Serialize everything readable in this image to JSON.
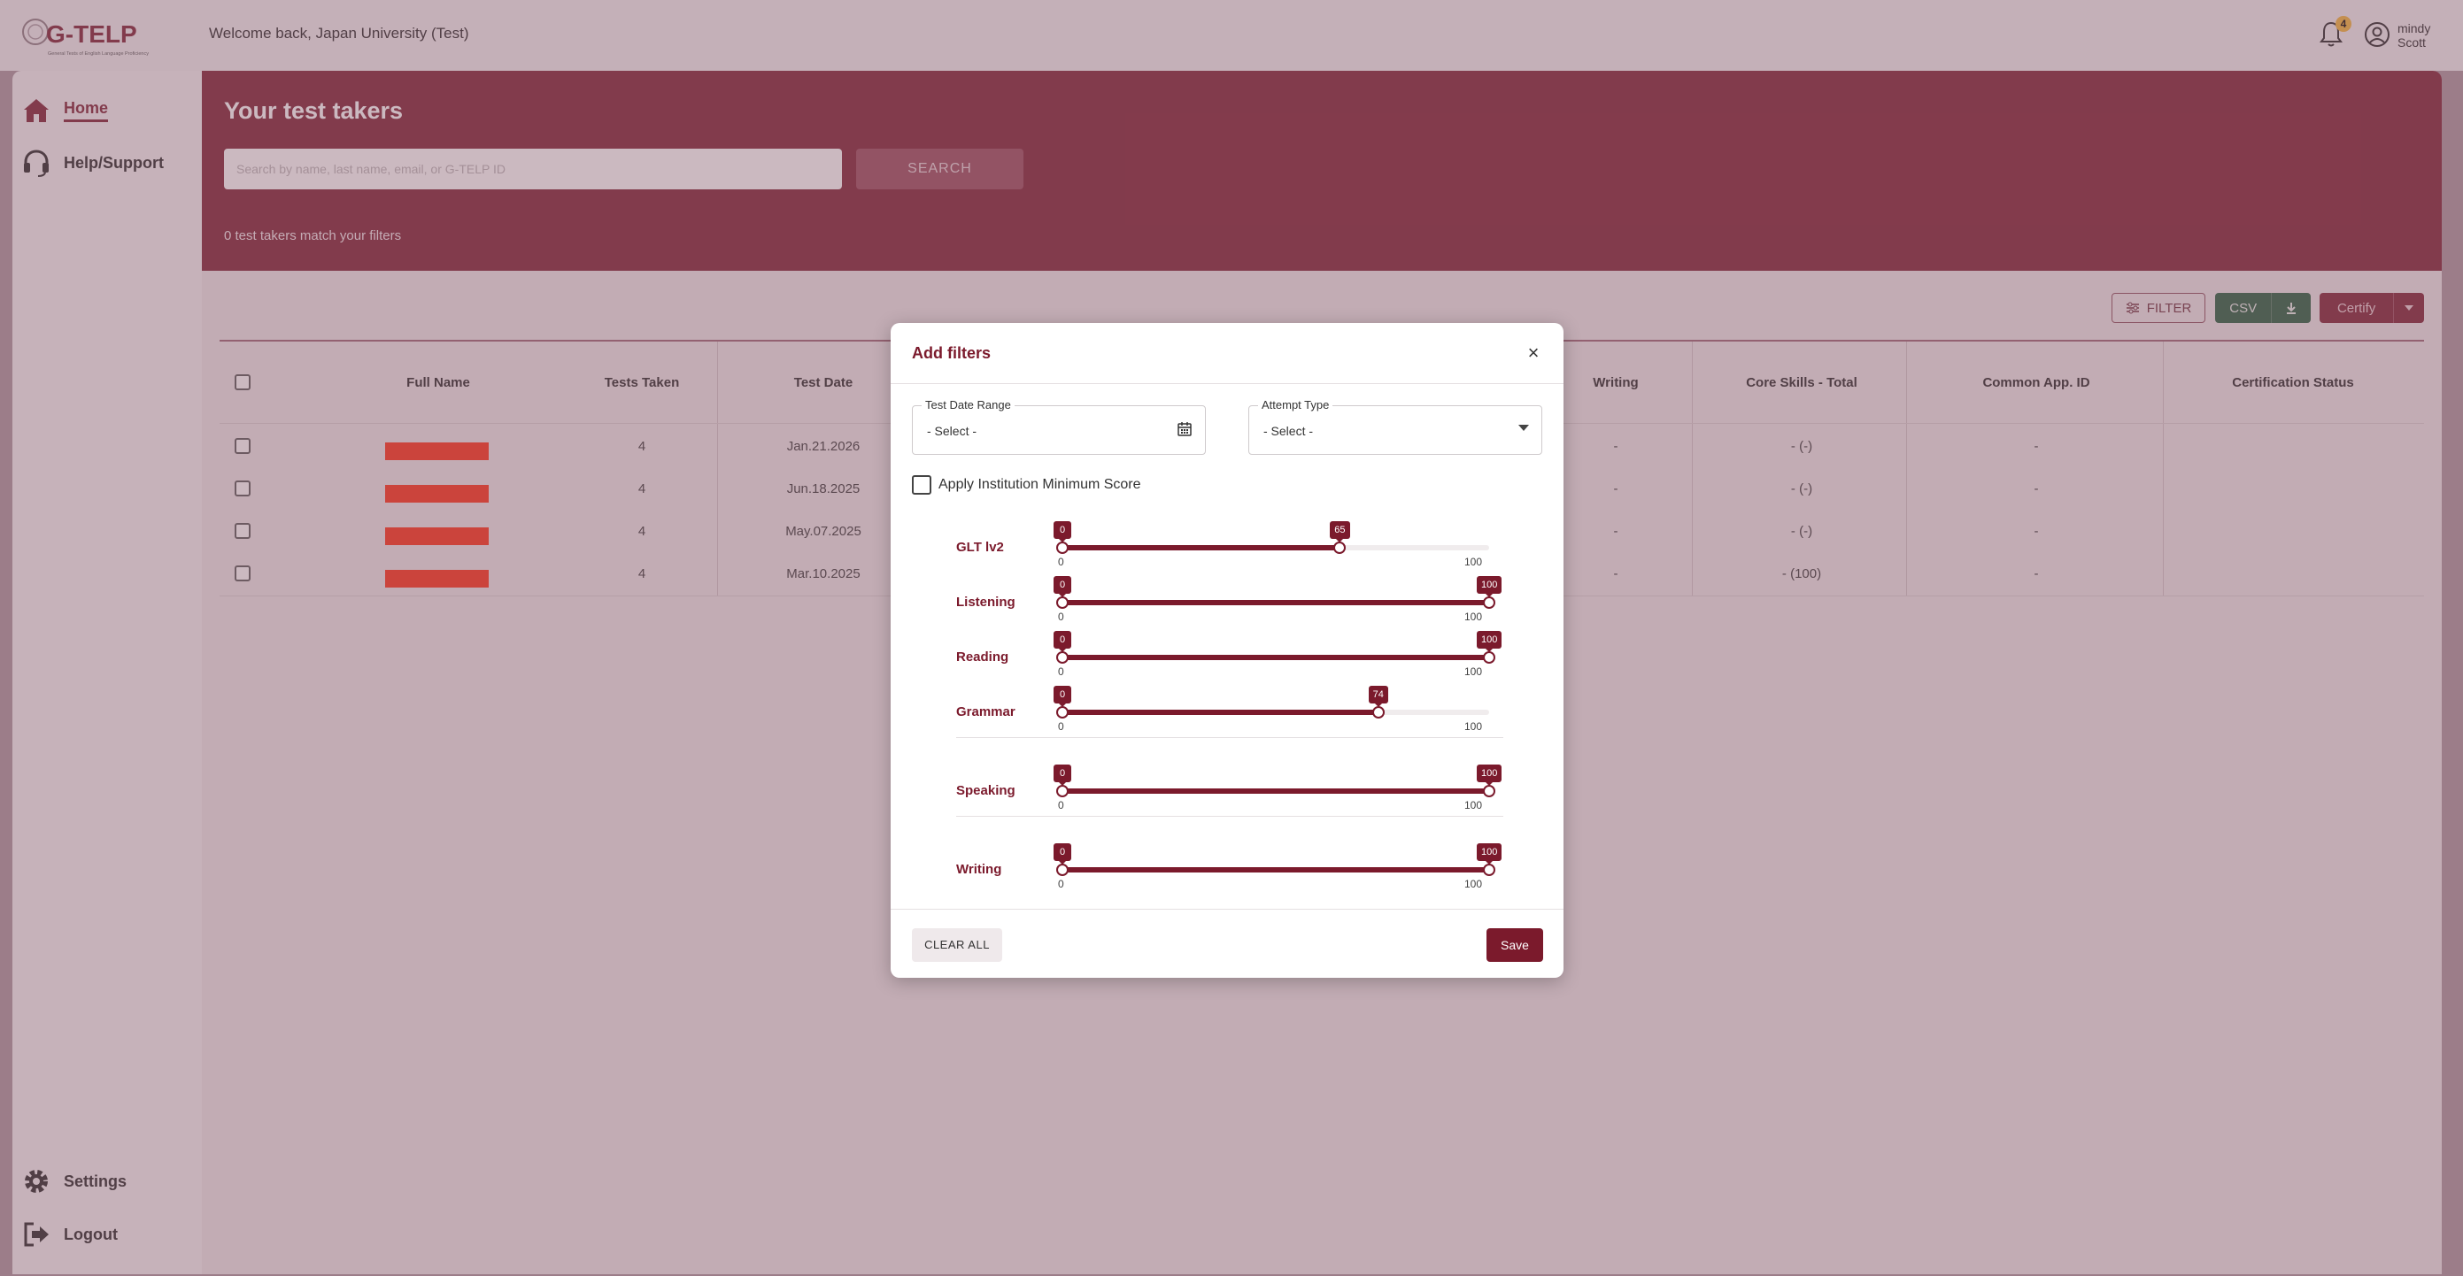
{
  "header": {
    "logo_text": "G-TELP",
    "logo_subtext": "General Tests of English Language Proficiency",
    "welcome": "Welcome back, Japan University (Test)",
    "notification_count": "4",
    "user_first": "mindy",
    "user_last": "Scott"
  },
  "sidebar": {
    "home": "Home",
    "help": "Help/Support",
    "settings": "Settings",
    "logout": "Logout"
  },
  "hero": {
    "title": "Your test takers",
    "search_placeholder": "Search by name, last name, email, or G-TELP ID",
    "search_button": "SEARCH",
    "match_count": "0 test takers match your filters"
  },
  "toolbar": {
    "filter": "FILTER",
    "csv": "CSV",
    "certify": "Certify"
  },
  "table": {
    "headers": {
      "full_name": "Full Name",
      "tests_taken": "Tests Taken",
      "test_date": "Test Date",
      "writing": "Writing",
      "core_skills_total": "Core Skills - Total",
      "common_app_id": "Common App. ID",
      "certification_status": "Certification Status"
    },
    "rows": [
      {
        "tests_taken": "4",
        "test_date": "Jan.21.2026",
        "writing": "-",
        "core_total": "- (-)",
        "common_id": "-"
      },
      {
        "tests_taken": "4",
        "test_date": "Jun.18.2025",
        "writing": "-",
        "core_total": "- (-)",
        "common_id": "-"
      },
      {
        "tests_taken": "4",
        "test_date": "May.07.2025",
        "writing": "-",
        "core_total": "- (-)",
        "common_id": "-"
      },
      {
        "tests_taken": "4",
        "test_date": "Mar.10.2025",
        "writing": "-",
        "core_total": "- (100)",
        "common_id": "-"
      }
    ]
  },
  "modal": {
    "title": "Add filters",
    "close": "×",
    "date_range_label": "Test Date Range",
    "date_range_value": "- Select -",
    "attempt_label": "Attempt Type",
    "attempt_value": "- Select -",
    "min_score_label": "Apply Institution Minimum Score",
    "sliders": [
      {
        "label": "GLT lv2",
        "low": 0,
        "high": 65,
        "min_label": "0",
        "max_label": "100",
        "low_tip": "0",
        "high_tip": "65"
      },
      {
        "label": "Listening",
        "low": 0,
        "high": 100,
        "min_label": "0",
        "max_label": "100",
        "low_tip": "0",
        "high_tip": "100"
      },
      {
        "label": "Reading",
        "low": 0,
        "high": 100,
        "min_label": "0",
        "max_label": "100",
        "low_tip": "0",
        "high_tip": "100"
      },
      {
        "label": "Grammar",
        "low": 0,
        "high": 74,
        "min_label": "0",
        "max_label": "100",
        "low_tip": "0",
        "high_tip": "74"
      },
      {
        "label": "Speaking",
        "low": 0,
        "high": 100,
        "min_label": "0",
        "max_label": "100",
        "low_tip": "0",
        "high_tip": "100"
      },
      {
        "label": "Writing",
        "low": 0,
        "high": 100,
        "min_label": "0",
        "max_label": "100",
        "low_tip": "0",
        "high_tip": "100"
      }
    ],
    "clear_all": "CLEAR ALL",
    "save": "Save"
  },
  "colors": {
    "brand": "#7b1a2c",
    "csv_green": "#1f5a3a",
    "badge": "#f2b233"
  }
}
